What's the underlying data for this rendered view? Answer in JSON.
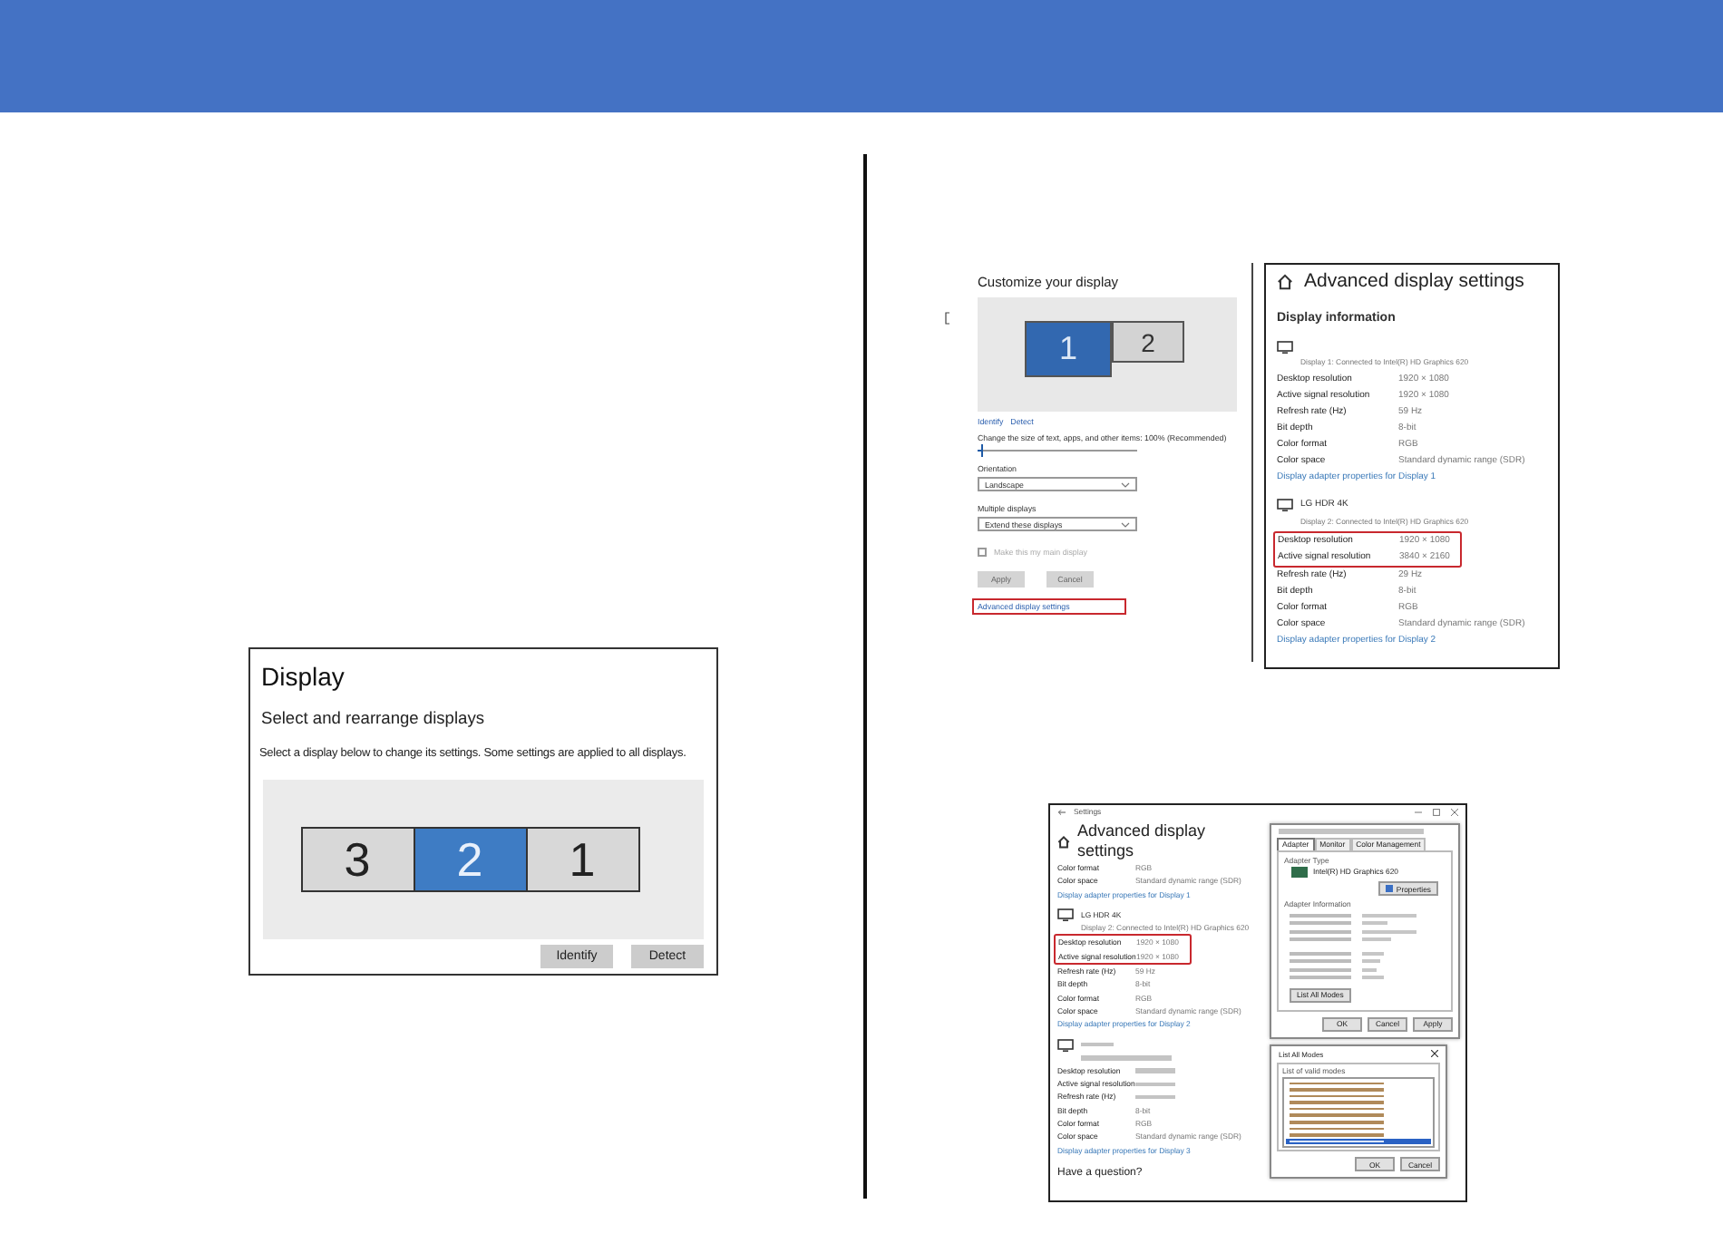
{
  "display_panel": {
    "title": "Display",
    "subtitle": "Select and rearrange displays",
    "description": "Select a display below to change its settings. Some settings are applied to all displays.",
    "monitors": [
      {
        "label": "3",
        "selected": false
      },
      {
        "label": "2",
        "selected": true
      },
      {
        "label": "1",
        "selected": false
      }
    ],
    "buttons": [
      "Identify",
      "Detect"
    ]
  },
  "customize_panel": {
    "title": "Customize your display",
    "monitors": [
      {
        "label": "1",
        "selected": true
      },
      {
        "label": "2",
        "selected": false
      }
    ],
    "links": [
      "Identify",
      "Detect"
    ],
    "scale_label": "Change the size of text, apps, and other items: 100% (Recommended)",
    "scale_slider": {
      "level": 0.02
    },
    "orientation": {
      "label": "Orientation",
      "value": "Landscape"
    },
    "multiple_displays": {
      "label": "Multiple displays",
      "value": "Extend these displays"
    },
    "main_display": {
      "label": "Make this my main display",
      "checked": false,
      "disabled": true
    },
    "buttons": [
      {
        "label": "Apply",
        "disabled": true
      },
      {
        "label": "Cancel",
        "disabled": true
      }
    ],
    "advanced_link": {
      "label": "Advanced display settings",
      "highlighted": true
    }
  },
  "advanced_panel": {
    "title": "Advanced display settings",
    "section": "Display information",
    "displays": [
      {
        "connection": "Display 1: Connected to Intel(R) HD Graphics 620",
        "rows": [
          {
            "label": "Desktop resolution",
            "value": "1920 × 1080",
            "highlighted": false
          },
          {
            "label": "Active signal resolution",
            "value": "1920 × 1080",
            "highlighted": false
          },
          {
            "label": "Refresh rate (Hz)",
            "value": "59 Hz",
            "highlighted": false
          },
          {
            "label": "Bit depth",
            "value": "8-bit",
            "highlighted": false
          },
          {
            "label": "Color format",
            "value": "RGB",
            "highlighted": false
          },
          {
            "label": "Color space",
            "value": "Standard dynamic range (SDR)",
            "highlighted": false
          }
        ],
        "link": "Display adapter properties for Display 1"
      },
      {
        "name": "LG HDR 4K",
        "connection": "Display 2: Connected to Intel(R) HD Graphics 620",
        "rows": [
          {
            "label": "Desktop resolution",
            "value": "1920 × 1080",
            "highlighted": true
          },
          {
            "label": "Active signal resolution",
            "value": "3840 × 2160",
            "highlighted": true
          },
          {
            "label": "Refresh rate (Hz)",
            "value": "29 Hz",
            "highlighted": false
          },
          {
            "label": "Bit depth",
            "value": "8-bit",
            "highlighted": false
          },
          {
            "label": "Color format",
            "value": "RGB",
            "highlighted": false
          },
          {
            "label": "Color space",
            "value": "Standard dynamic range (SDR)",
            "highlighted": false
          }
        ],
        "link": "Display adapter properties for Display 2"
      }
    ]
  },
  "combined_panel": {
    "window_title": "Settings",
    "title": "Advanced display settings",
    "displays": [
      {
        "rows": [
          {
            "label": "Color format",
            "value": "RGB",
            "highlighted": false
          },
          {
            "label": "Color space",
            "value": "Standard dynamic range (SDR)",
            "highlighted": false
          }
        ],
        "link": "Display adapter properties for Display 1"
      },
      {
        "name": "LG HDR 4K",
        "connection": "Display 2: Connected to Intel(R) HD Graphics 620",
        "rows": [
          {
            "label": "Desktop resolution",
            "value": "1920 × 1080",
            "highlighted": true
          },
          {
            "label": "Active signal resolution",
            "value": "1920 × 1080",
            "highlighted": true
          },
          {
            "label": "Refresh rate (Hz)",
            "value": "59 Hz",
            "highlighted": false
          },
          {
            "label": "Bit depth",
            "value": "8-bit",
            "highlighted": false
          },
          {
            "label": "Color format",
            "value": "RGB",
            "highlighted": false
          },
          {
            "label": "Color space",
            "value": "Standard dynamic range (SDR)",
            "highlighted": false
          }
        ],
        "link": "Display adapter properties for Display 2"
      },
      {
        "rows": [
          {
            "label": "Desktop resolution",
            "highlighted": false
          },
          {
            "label": "Active signal resolution",
            "highlighted": false
          },
          {
            "label": "Refresh rate (Hz)",
            "highlighted": false
          },
          {
            "label": "Bit depth",
            "value": "8-bit",
            "highlighted": false
          },
          {
            "label": "Color format",
            "value": "RGB",
            "highlighted": false
          },
          {
            "label": "Color space",
            "value": "Standard dynamic range (SDR)",
            "highlighted": false
          }
        ],
        "link": "Display adapter properties for Display 3"
      }
    ],
    "footer": "Have a question?"
  },
  "properties_dialog": {
    "tabs": [
      {
        "label": "Adapter",
        "selected": true
      },
      {
        "label": "Monitor",
        "selected": false
      },
      {
        "label": "Color Management",
        "selected": false
      }
    ],
    "adapter_type_label": "Adapter Type",
    "adapter_name": "Intel(R) HD Graphics 620",
    "properties_button": "Properties",
    "info_label": "Adapter Information",
    "list_modes_button": "List All Modes",
    "buttons": [
      "OK",
      "Cancel",
      "Apply"
    ]
  },
  "modes_dialog": {
    "title": "List All Modes",
    "list_label": "List of valid modes",
    "modes": [
      {
        "selected": false
      },
      {
        "selected": false
      },
      {
        "selected": false
      },
      {
        "selected": false
      },
      {
        "selected": false
      },
      {
        "selected": false
      },
      {
        "selected": false
      },
      {
        "selected": false
      },
      {
        "selected": false
      },
      {
        "selected": true
      }
    ],
    "buttons": [
      "OK",
      "Cancel"
    ]
  }
}
